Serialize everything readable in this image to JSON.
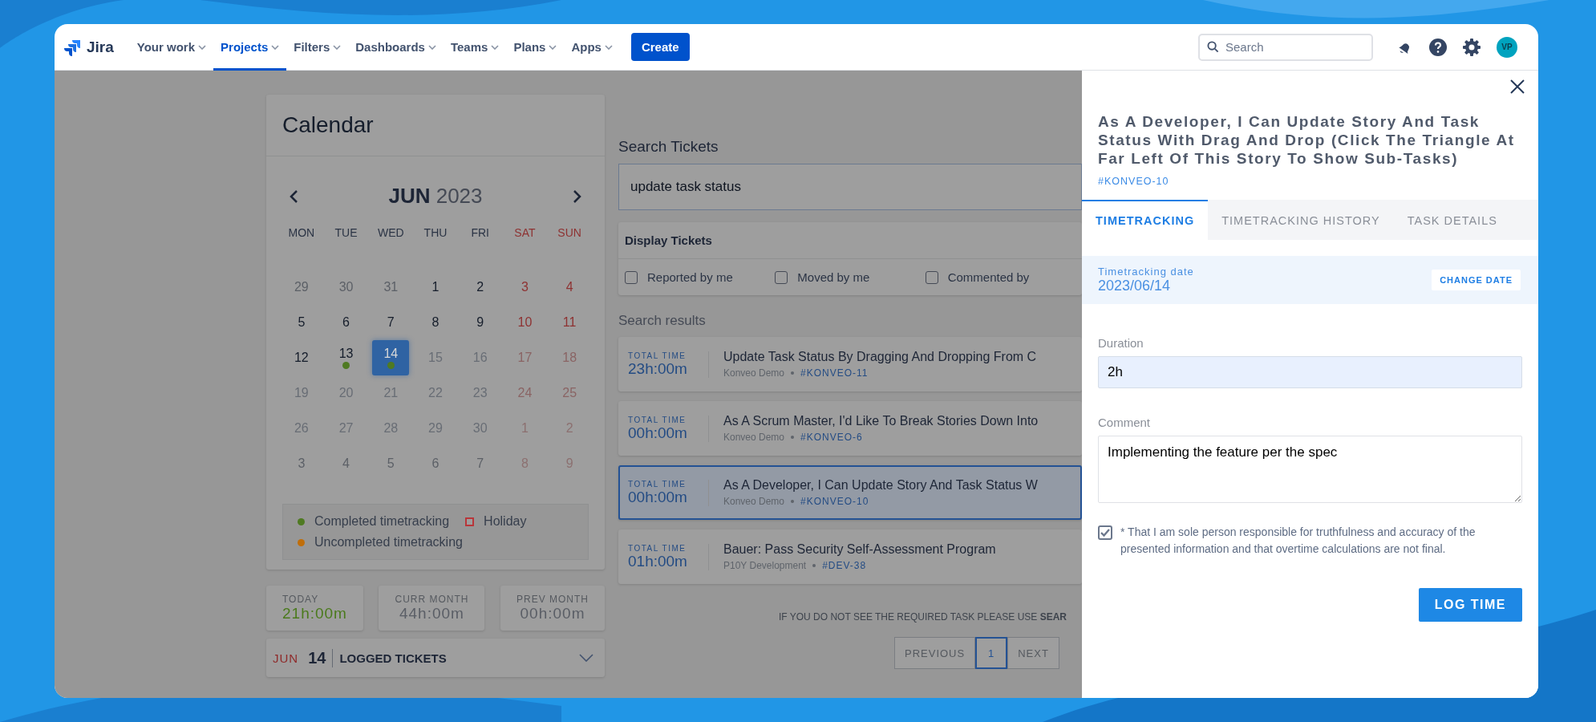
{
  "nav": {
    "logo": "Jira",
    "items": [
      {
        "label": "Your work",
        "selected": false
      },
      {
        "label": "Projects",
        "selected": true
      },
      {
        "label": "Filters",
        "selected": false
      },
      {
        "label": "Dashboards",
        "selected": false
      },
      {
        "label": "Teams",
        "selected": false
      },
      {
        "label": "Plans",
        "selected": false
      },
      {
        "label": "Apps",
        "selected": false
      }
    ],
    "create": "Create",
    "search_placeholder": "Search",
    "avatar": "VP"
  },
  "calendar": {
    "title": "Calendar",
    "month": "JUN",
    "year": "2023",
    "weekdays": [
      {
        "label": "MON",
        "weekend": false
      },
      {
        "label": "TUE",
        "weekend": false
      },
      {
        "label": "WED",
        "weekend": false
      },
      {
        "label": "THU",
        "weekend": false
      },
      {
        "label": "FRI",
        "weekend": false
      },
      {
        "label": "SAT",
        "weekend": true
      },
      {
        "label": "SUN",
        "weekend": true
      }
    ],
    "weeks": [
      [
        {
          "day": "29",
          "kind": "outside",
          "weekend": false,
          "selected": false
        },
        {
          "day": "30",
          "kind": "outside",
          "weekend": false,
          "selected": false
        },
        {
          "day": "31",
          "kind": "outside",
          "weekend": false,
          "selected": false
        },
        {
          "day": "1",
          "kind": "past",
          "weekend": false,
          "selected": false
        },
        {
          "day": "2",
          "kind": "past",
          "weekend": false,
          "selected": false
        },
        {
          "day": "3",
          "kind": "past",
          "weekend": true,
          "selected": false
        },
        {
          "day": "4",
          "kind": "past",
          "weekend": true,
          "selected": false
        }
      ],
      [
        {
          "day": "5",
          "kind": "past",
          "weekend": false,
          "selected": false
        },
        {
          "day": "6",
          "kind": "past",
          "weekend": false,
          "selected": false
        },
        {
          "day": "7",
          "kind": "past",
          "weekend": false,
          "selected": false
        },
        {
          "day": "8",
          "kind": "past",
          "weekend": false,
          "selected": false
        },
        {
          "day": "9",
          "kind": "past",
          "weekend": false,
          "selected": false
        },
        {
          "day": "10",
          "kind": "past",
          "weekend": true,
          "selected": false
        },
        {
          "day": "11",
          "kind": "past",
          "weekend": true,
          "selected": false
        }
      ],
      [
        {
          "day": "12",
          "kind": "past",
          "weekend": false,
          "selected": false
        },
        {
          "day": "13",
          "kind": "past",
          "weekend": false,
          "selected": false,
          "color": "#4f7a22"
        },
        {
          "day": "14",
          "kind": "past",
          "weekend": false,
          "selected": true,
          "color": "#4f7a22"
        },
        {
          "day": "15",
          "kind": "future",
          "weekend": false,
          "selected": false
        },
        {
          "day": "16",
          "kind": "future",
          "weekend": false,
          "selected": false
        },
        {
          "day": "17",
          "kind": "future",
          "weekend": true,
          "selected": false
        },
        {
          "day": "18",
          "kind": "future",
          "weekend": true,
          "selected": false
        }
      ],
      [
        {
          "day": "19",
          "kind": "future",
          "weekend": false,
          "selected": false
        },
        {
          "day": "20",
          "kind": "future",
          "weekend": false,
          "selected": false
        },
        {
          "day": "21",
          "kind": "future",
          "weekend": false,
          "selected": false
        },
        {
          "day": "22",
          "kind": "future",
          "weekend": false,
          "selected": false
        },
        {
          "day": "23",
          "kind": "future",
          "weekend": false,
          "selected": false
        },
        {
          "day": "24",
          "kind": "future",
          "weekend": true,
          "selected": false
        },
        {
          "day": "25",
          "kind": "future",
          "weekend": true,
          "selected": false
        }
      ],
      [
        {
          "day": "26",
          "kind": "future",
          "weekend": false,
          "selected": false
        },
        {
          "day": "27",
          "kind": "future",
          "weekend": false,
          "selected": false
        },
        {
          "day": "28",
          "kind": "future",
          "weekend": false,
          "selected": false
        },
        {
          "day": "29",
          "kind": "future",
          "weekend": false,
          "selected": false
        },
        {
          "day": "30",
          "kind": "future",
          "weekend": false,
          "selected": false
        },
        {
          "day": "1",
          "kind": "outside",
          "weekend": true,
          "selected": false
        },
        {
          "day": "2",
          "kind": "outside",
          "weekend": true,
          "selected": false
        }
      ],
      [
        {
          "day": "3",
          "kind": "outside",
          "weekend": false,
          "selected": false
        },
        {
          "day": "4",
          "kind": "outside",
          "weekend": false,
          "selected": false
        },
        {
          "day": "5",
          "kind": "outside",
          "weekend": false,
          "selected": false
        },
        {
          "day": "6",
          "kind": "outside",
          "weekend": false,
          "selected": false
        },
        {
          "day": "7",
          "kind": "outside",
          "weekend": false,
          "selected": false
        },
        {
          "day": "8",
          "kind": "outside",
          "weekend": true,
          "selected": false
        },
        {
          "day": "9",
          "kind": "outside",
          "weekend": true,
          "selected": false
        }
      ]
    ],
    "legend": [
      {
        "label": "Completed timetracking",
        "kind": "dot",
        "color": "#4f7a22"
      },
      {
        "label": "Holiday",
        "kind": "square",
        "color": "#b8363a"
      },
      {
        "label": "Uncompleted timetracking",
        "kind": "dot",
        "color": "#c06e0a"
      }
    ]
  },
  "stats": [
    {
      "label": "TODAY",
      "value": "21h:00m",
      "color": "#4a7a1c"
    },
    {
      "label": "CURR MONTH",
      "value": "44h:00m",
      "color": "#5a5e66"
    },
    {
      "label": "PREV MONTH",
      "value": "00h:00m",
      "color": "#5a5e66"
    }
  ],
  "logged": {
    "month": "JUN",
    "day": "14",
    "label": "LOGGED TICKETS",
    "expanded": false
  },
  "search": {
    "title": "Search Tickets",
    "value": "update task status",
    "display_title": "Display Tickets",
    "filters": [
      {
        "label": "Reported by me",
        "checked": false
      },
      {
        "label": "Moved by me",
        "checked": false
      },
      {
        "label": "Commented by",
        "checked": false
      }
    ],
    "results_title": "Search results",
    "results": [
      {
        "time_label": "TOTAL TIME",
        "time": "23h:00m",
        "title": "Update Task Status By Dragging And Dropping From C",
        "project": "Konveo Demo",
        "key": "#KONVEO-11",
        "selected": false
      },
      {
        "time_label": "TOTAL TIME",
        "time": "00h:00m",
        "title": "As A Scrum Master, I'd Like To Break Stories Down Into",
        "project": "Konveo Demo",
        "key": "#KONVEO-6",
        "selected": false
      },
      {
        "time_label": "TOTAL TIME",
        "time": "00h:00m",
        "title": "As A Developer, I Can Update Story And Task Status W",
        "project": "Konveo Demo",
        "key": "#KONVEO-10",
        "selected": true
      },
      {
        "time_label": "TOTAL TIME",
        "time": "01h:00m",
        "title": "Bauer: Pass Security Self-Assessment Program",
        "project": "P10Y Development",
        "key": "#DEV-38",
        "selected": false
      }
    ],
    "footer": "IF YOU DO NOT SEE THE REQUIRED TASK PLEASE USE **SEAR**",
    "pagination": {
      "previous": "PREVIOUS",
      "pages": [
        {
          "label": "1",
          "selected": true
        }
      ],
      "next": "NEXT"
    }
  },
  "panel": {
    "title": "As A Developer, I Can Update Story And Task Status With Drag And Drop (Click The Triangle At Far Left Of This Story To Show Sub-Tasks)",
    "key": "#KONVEO-10",
    "tabs": [
      {
        "label": "TIMETRACKING",
        "selected": true
      },
      {
        "label": "TIMETRACKING HISTORY",
        "selected": false
      },
      {
        "label": "TASK DETAILS",
        "selected": false
      }
    ],
    "date_label": "Timetracking date",
    "date": "2023/06/14",
    "change_date": "CHANGE DATE",
    "duration_label": "Duration",
    "duration": "2h",
    "comment_label": "Comment",
    "comment": "Implementing the feature per the spec",
    "agree_text": "* That I am sole person responsible for truthfulness and accuracy of the presented information and that overtime calculations are not final.",
    "agree_checked": true,
    "log_time": "LOG TIME"
  }
}
